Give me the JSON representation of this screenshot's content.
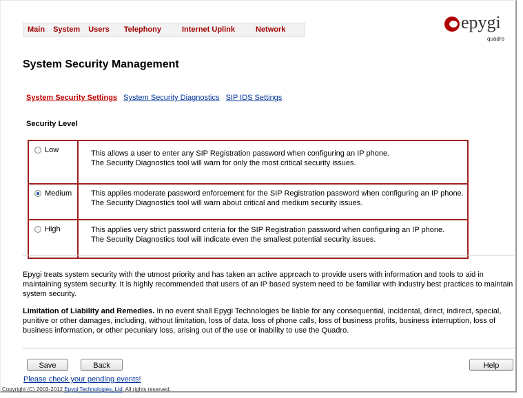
{
  "nav": {
    "items": [
      {
        "label": "Main"
      },
      {
        "label": "System"
      },
      {
        "label": "Users"
      },
      {
        "label": "Telephony"
      },
      {
        "label": "Internet Uplink"
      },
      {
        "label": "Network"
      }
    ]
  },
  "logo": {
    "word": "epygi",
    "sub": "quadro"
  },
  "page": {
    "title": "System Security Management"
  },
  "subtabs": [
    {
      "label": "System Security Settings",
      "active": true
    },
    {
      "label": "System Security Diagnostics",
      "active": false
    },
    {
      "label": "SIP IDS Settings",
      "active": false
    }
  ],
  "security": {
    "label": "Security Level",
    "selected": "Medium",
    "levels": [
      {
        "name": "Low",
        "line1": "This allows a user to enter any SIP Registration password when configuring an IP phone.",
        "line2": "The Security Diagnostics tool will warn for only the most critical security issues."
      },
      {
        "name": "Medium",
        "line1": "This applies moderate password enforcement for the SIP Registration password when configuring an IP phone.",
        "line2": "The Security Diagnostics tool will warn about critical and medium security issues."
      },
      {
        "name": "High",
        "line1": "This applies very strict password criteria for the SIP Registration password when configuring an IP phone.",
        "line2": "The Security Diagnostics tool will indicate even the smallest potential security issues."
      }
    ]
  },
  "notice": {
    "para1": "Epygi treats system security with the utmost priority and has taken an active approach to provide users with information and tools to aid in maintaining system security. It is highly recommended that users of an IP based system need to be familiar with industry best practices to maintain system security.",
    "para2_bold": "Limitation of Liability and Remedies.",
    "para2_rest": " In no event shall Epygi Technologies be liable for any consequential, incidental, direct, indirect, special, punitive or other damages, including, without limitation, loss of data, loss of phone calls, loss of business profits, business interruption, loss of business information, or other pecuniary loss, arising out of the use or inability to use the Quadro."
  },
  "buttons": {
    "save": "Save",
    "back": "Back",
    "help": "Help"
  },
  "footer": {
    "pending": "Please check your pending events!",
    "copy_prefix": "Copyright (C) 2003-2012 ",
    "copy_link": "Epygi Technologies, Ltd",
    "copy_suffix": ". All rights reserved."
  }
}
